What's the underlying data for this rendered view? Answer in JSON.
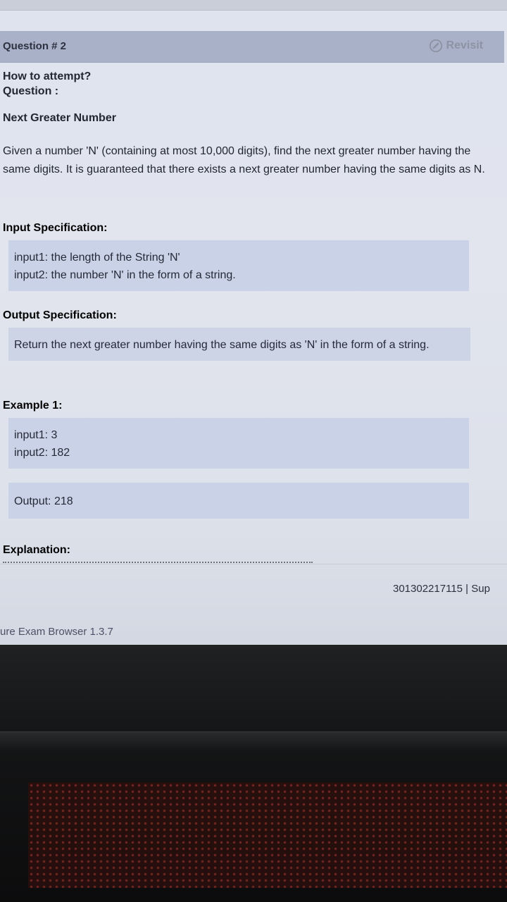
{
  "header": {
    "question_number": "Question # 2",
    "revisit_label": "Revisit"
  },
  "intro": {
    "how_to_attempt": "How to attempt?",
    "question_label": "Question :"
  },
  "problem": {
    "name": "Next Greater Number",
    "description": "Given a number 'N' (containing at most 10,000 digits), find the next greater number having the same digits. It is guaranteed that there exists a next greater number having the same digits as N."
  },
  "input_spec": {
    "title": "Input Specification:",
    "input1_label": "input1:",
    "input1_text": "the length of the String 'N'",
    "input2_label": "input2:",
    "input2_text": "the number 'N' in the form of a string."
  },
  "output_spec": {
    "title": "Output Specification:",
    "text": "Return the next greater number having the same digits as 'N' in the form of a string."
  },
  "example1": {
    "title": "Example 1:",
    "input1_label": "input1:",
    "input1_value": "3",
    "input2_label": "input2:",
    "input2_value": "182",
    "output_label": "Output:",
    "output_value": "218"
  },
  "explanation": {
    "title": "Explanation:"
  },
  "status_bar": {
    "id_text": "301302217115 | Sup"
  },
  "app": {
    "browser_name": "ure Exam Browser 1.3.7"
  },
  "colors": {
    "header_bg": "#a9b1c8",
    "box_bg": "#c9d2e6",
    "text": "#232633",
    "revisit": "#8d93a4"
  },
  "icons": {
    "revisit": "revisit-refresh-icon"
  }
}
